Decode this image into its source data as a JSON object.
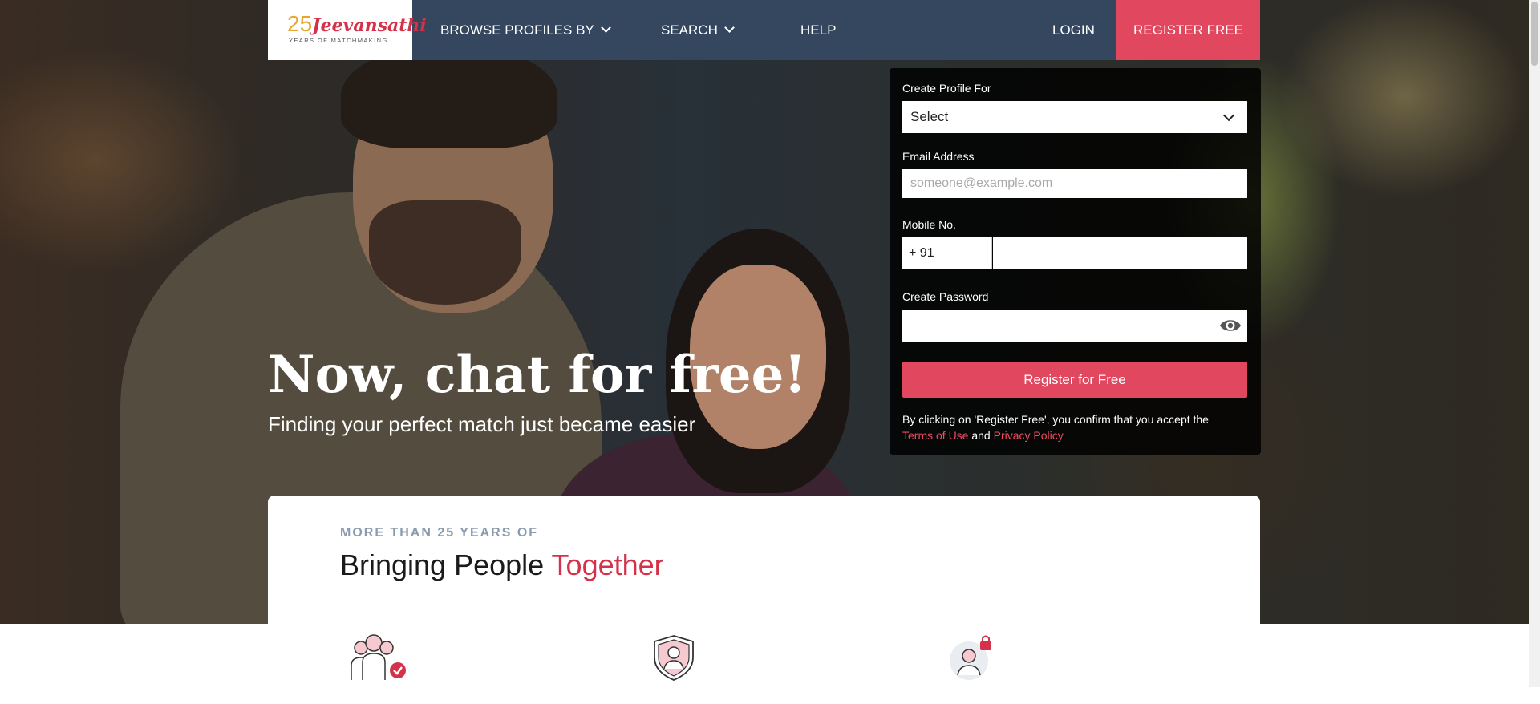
{
  "nav": {
    "logo": {
      "number": "25",
      "name": "Jeevansathi",
      "tagline": "YEARS OF MATCHMAKING"
    },
    "items": [
      {
        "label": "BROWSE PROFILES BY",
        "dropdown": true
      },
      {
        "label": "SEARCH",
        "dropdown": true
      },
      {
        "label": "HELP",
        "dropdown": false
      }
    ],
    "login_label": "LOGIN",
    "register_label": "REGISTER FREE"
  },
  "hero": {
    "title": "Now, chat for free!",
    "subtitle": "Finding your perfect match just became easier"
  },
  "form": {
    "profile_for_label": "Create Profile For",
    "profile_for_value": "Select",
    "email_label": "Email Address",
    "email_placeholder": "someone@example.com",
    "email_value": "",
    "mobile_label": "Mobile No.",
    "country_code": "+ 91",
    "mobile_value": "",
    "password_label": "Create Password",
    "password_value": "",
    "submit_label": "Register for Free",
    "terms_prefix": "By clicking on 'Register Free', you confirm that you accept the",
    "terms_link": "Terms of Use",
    "terms_and": "and",
    "privacy_link": "Privacy Policy"
  },
  "section": {
    "kicker": "MORE THAN 25 YEARS OF",
    "title_main": "Bringing People",
    "title_accent": "Together"
  },
  "icons": [
    "group-verified-icon",
    "shield-user-icon",
    "user-lock-icon"
  ],
  "colors": {
    "nav_bg": "#35475f",
    "accent": "#e1475f",
    "brand_red": "#d4324a",
    "brand_gold": "#e7a62e"
  }
}
